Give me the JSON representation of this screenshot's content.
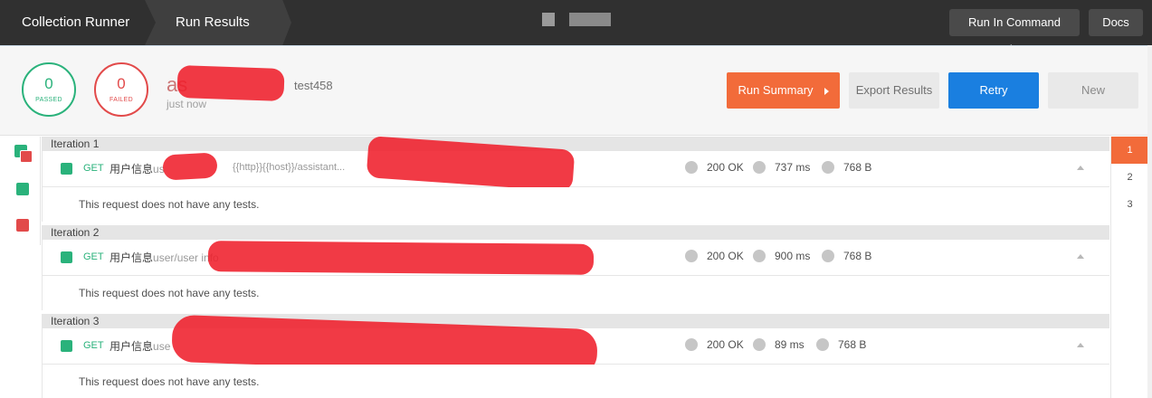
{
  "topbar": {
    "crumbs": [
      "Collection Runner",
      "Run Results"
    ],
    "buttons": {
      "command_line": "Run In Command Line",
      "docs": "Docs"
    }
  },
  "summary": {
    "passed": {
      "count": "0",
      "label": "PASSED"
    },
    "failed": {
      "count": "0",
      "label": "FAILED"
    },
    "collection_name": "as",
    "environment": "test458",
    "time": "just now",
    "actions": {
      "run_summary": "Run Summary",
      "export": "Export Results",
      "retry": "Retry",
      "new": "New"
    }
  },
  "iterations": [
    {
      "title": "Iteration 1",
      "request": {
        "method": "GET",
        "name": "用户信息",
        "name_suffix": "us",
        "url": "{{http}}{{host}}/assistant...",
        "status": "200 OK",
        "time": "737 ms",
        "size": "768 B"
      },
      "tests": "This request does not have any tests."
    },
    {
      "title": "Iteration 2",
      "request": {
        "method": "GET",
        "name": "用户信息",
        "name_suffix": "user/user info",
        "url": "",
        "status": "200 OK",
        "time": "900 ms",
        "size": "768 B"
      },
      "tests": "This request does not have any tests."
    },
    {
      "title": "Iteration 3",
      "request": {
        "method": "GET",
        "name": "用户信息",
        "name_suffix": "use",
        "url": "",
        "status": "200 OK",
        "time": "89 ms",
        "size": "768 B"
      },
      "tests": "This request does not have any tests."
    }
  ],
  "iteration_nav": [
    "1",
    "2",
    "3"
  ],
  "colors": {
    "accent_orange": "#f26b3a",
    "pass_green": "#2ab27b",
    "fail_red": "#e24a4a",
    "retry_blue": "#1a7fe0"
  }
}
